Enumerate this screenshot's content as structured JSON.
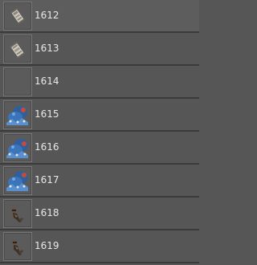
{
  "items": [
    {
      "id": "1612",
      "icon": "scroll-icon"
    },
    {
      "id": "1613",
      "icon": "scroll-icon"
    },
    {
      "id": "1614",
      "icon": "empty-icon"
    },
    {
      "id": "1615",
      "icon": "blue-creature-icon"
    },
    {
      "id": "1616",
      "icon": "blue-creature-icon"
    },
    {
      "id": "1617",
      "icon": "blue-creature-icon"
    },
    {
      "id": "1618",
      "icon": "dark-figure-icon"
    },
    {
      "id": "1619",
      "icon": "dark-figure-icon"
    }
  ],
  "colors": {
    "background": "#565656",
    "divider": "#3b3b3b",
    "text": "#e8e8e8",
    "thumb_border": "#777777"
  }
}
